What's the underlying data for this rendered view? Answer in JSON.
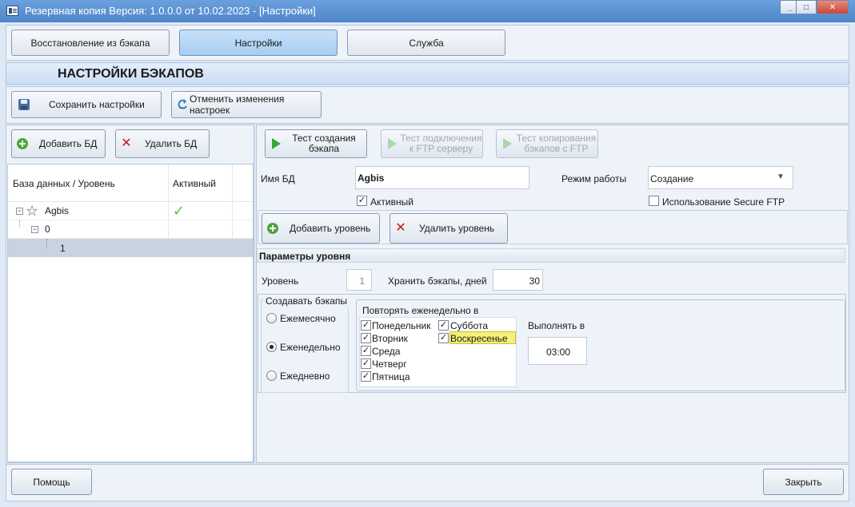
{
  "window": {
    "title": "Резервная копия   Версия: 1.0.0.0 от 10.02.2023 - [Настройки]"
  },
  "tabs": [
    {
      "label": "Восстановление из бэкапа",
      "active": false
    },
    {
      "label": "Настройки",
      "active": true
    },
    {
      "label": "Служба",
      "active": false
    }
  ],
  "section_title": "НАСТРОЙКИ БЭКАПОВ",
  "toolbar": {
    "save_label": "Сохранить настройки",
    "cancel_label": "Отменить изменения настроек"
  },
  "db_panel": {
    "add_label": "Добавить БД",
    "delete_label": "Удалить БД",
    "columns": [
      "База данных / Уровень",
      "Активный"
    ],
    "tree": [
      {
        "label": "Agbis",
        "active": true
      },
      {
        "label": "0"
      },
      {
        "label": "1",
        "selected": true
      }
    ]
  },
  "actions": {
    "test_backup": "Тест создания бэкапа",
    "test_ftp_line1": "Тест подключения",
    "test_ftp_line2": "к FTP серверу",
    "test_copy_line1": "Тест копирования",
    "test_copy_line2": "бэкапов с FTP",
    "test_backup_line1": "Тест создания",
    "test_backup_line2": "бэкапа"
  },
  "db_settings": {
    "name_label": "Имя БД",
    "name_value": "Agbis",
    "active_label": "Активный",
    "active_checked": true,
    "mode_label": "Режим работы",
    "mode_value": "Создание",
    "sftp_label": "Использование Secure FTP",
    "sftp_checked": false
  },
  "levels": {
    "add_label": "Добавить уровень",
    "delete_label": "Удалить уровень"
  },
  "level_params": {
    "header": "Параметры уровня",
    "level_label": "Уровень",
    "level_value": "1",
    "keep_label": "Хранить бэкапы, дней",
    "keep_value": "30",
    "create_group": "Создавать бэкапы",
    "freq_options": [
      "Ежемесячно",
      "Еженедельно",
      "Ежедневно"
    ],
    "freq_selected": 1,
    "repeat_group": "Повторять еженедельно в",
    "days": [
      {
        "label": "Понедельник",
        "checked": true
      },
      {
        "label": "Вторник",
        "checked": true
      },
      {
        "label": "Среда",
        "checked": true
      },
      {
        "label": "Четверг",
        "checked": true
      },
      {
        "label": "Пятница",
        "checked": true
      },
      {
        "label": "Суббота",
        "checked": true
      },
      {
        "label": "Воскресенье",
        "checked": true
      }
    ],
    "run_label": "Выполнять в",
    "run_time": "03:00"
  },
  "footer": {
    "help_label": "Помощь",
    "close_label": "Закрыть"
  },
  "icons": {
    "check_mark": "✓",
    "dropdown_arrow": "▼",
    "star": "☆",
    "delete_x": "✕"
  },
  "colors": {
    "titlebar": "#4f86c9",
    "active_tab": "#a8cdf2",
    "selected_row": "#c9d3df",
    "highlight_field": "#f4f178"
  }
}
